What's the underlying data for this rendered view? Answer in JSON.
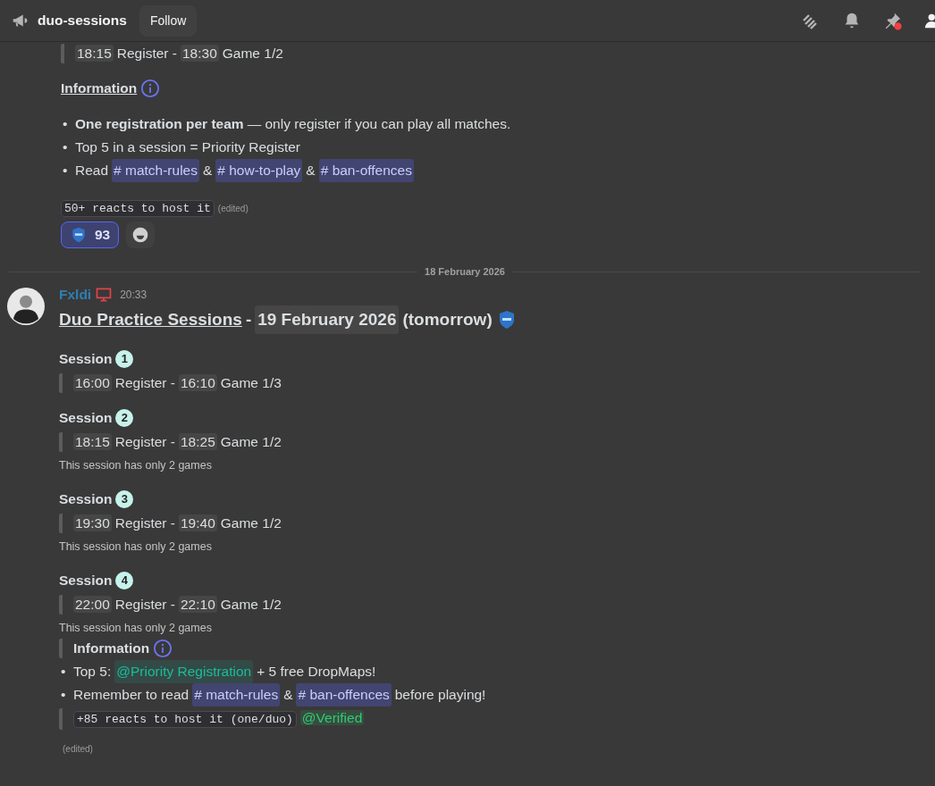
{
  "header": {
    "channel": "duo-sessions",
    "follow_button": "Follow",
    "pins_unread": true
  },
  "previous_message": {
    "blocks": [
      {
        "kind": "quote",
        "segments": [
          {
            "kind": "time",
            "text": "18:15"
          },
          {
            "kind": "text",
            "text": "Register -"
          },
          {
            "kind": "time",
            "text": "18:30"
          },
          {
            "kind": "text",
            "text": "Game 1/2"
          }
        ]
      },
      {
        "kind": "heading",
        "text": "Information"
      },
      {
        "kind": "bullets",
        "items": [
          {
            "marker": "•",
            "segments": [
              {
                "kind": "bold",
                "text": "One registration per team"
              },
              {
                "kind": "text",
                "text": "— only register if you can play all matches."
              }
            ]
          },
          {
            "marker": "•",
            "segments": [
              {
                "kind": "text",
                "text": "Top 5 in a session = Priority Register"
              }
            ]
          },
          {
            "marker": "•",
            "segments": [
              {
                "kind": "text",
                "text": "Read"
              },
              {
                "kind": "channel",
                "text": "# match-rules"
              },
              {
                "kind": "text",
                "text": "&"
              },
              {
                "kind": "channel",
                "text": "# how-to-play"
              },
              {
                "kind": "text",
                "text": "&"
              },
              {
                "kind": "channel",
                "text": "# ban-offences"
              }
            ]
          }
        ]
      },
      {
        "kind": "code_line",
        "segments": [
          {
            "kind": "code",
            "text": "50+ reacts to host it"
          },
          {
            "kind": "edited",
            "text": "(edited)"
          }
        ]
      }
    ],
    "reactions": [
      {
        "count": "93",
        "selected": true
      }
    ]
  },
  "date_divider": "18 February 2026",
  "message": {
    "author": "Fxldi",
    "time": "20:33",
    "title": [
      {
        "kind": "underline",
        "text": "Duo Practice Sessions"
      },
      {
        "kind": "text",
        "text": "-"
      },
      {
        "kind": "time",
        "text": "19 February 2026"
      },
      {
        "kind": "text",
        "text": "(tomorrow)"
      }
    ],
    "blocks": [
      {
        "kind": "session",
        "text": "Session",
        "number": "1"
      },
      {
        "kind": "quote",
        "segments": [
          {
            "kind": "time",
            "text": "16:00"
          },
          {
            "kind": "text",
            "text": "Register -"
          },
          {
            "kind": "time",
            "text": "16:10"
          },
          {
            "kind": "text",
            "text": "Game 1/3"
          }
        ]
      },
      {
        "kind": "session",
        "text": "Session",
        "number": "2"
      },
      {
        "kind": "quote",
        "segments": [
          {
            "kind": "time",
            "text": "18:15"
          },
          {
            "kind": "text",
            "text": "Register -"
          },
          {
            "kind": "time",
            "text": "18:25"
          },
          {
            "kind": "text",
            "text": "Game 1/2"
          }
        ]
      },
      {
        "kind": "note",
        "text": "This session has only 2 games"
      },
      {
        "kind": "session",
        "text": "Session",
        "number": "3"
      },
      {
        "kind": "quote",
        "segments": [
          {
            "kind": "time",
            "text": "19:30"
          },
          {
            "kind": "text",
            "text": "Register -"
          },
          {
            "kind": "time",
            "text": "19:40"
          },
          {
            "kind": "text",
            "text": "Game 1/2"
          }
        ]
      },
      {
        "kind": "note",
        "text": "This session has only 2 games"
      },
      {
        "kind": "session",
        "text": "Session",
        "number": "4"
      },
      {
        "kind": "quote",
        "segments": [
          {
            "kind": "time",
            "text": "22:00"
          },
          {
            "kind": "text",
            "text": "Register -"
          },
          {
            "kind": "time",
            "text": "22:10"
          },
          {
            "kind": "text",
            "text": "Game 1/2"
          }
        ]
      },
      {
        "kind": "note",
        "text": "This session has only 2 games"
      },
      {
        "kind": "quote_heading",
        "text": "Information"
      },
      {
        "kind": "bullets",
        "items": [
          {
            "marker": "•",
            "segments": [
              {
                "kind": "text",
                "text": "Top 5:"
              },
              {
                "kind": "role",
                "text": "@Priority Registration",
                "color": "#1abc9c"
              },
              {
                "kind": "text",
                "text": "+ 5 free DropMaps!"
              }
            ]
          },
          {
            "marker": "•",
            "segments": [
              {
                "kind": "text",
                "text": "Remember to read"
              },
              {
                "kind": "channel",
                "text": "# match-rules"
              },
              {
                "kind": "text",
                "text": "&"
              },
              {
                "kind": "channel",
                "text": "# ban-offences"
              },
              {
                "kind": "text",
                "text": "before playing!"
              }
            ]
          }
        ]
      },
      {
        "kind": "quote",
        "segments": [
          {
            "kind": "code",
            "text": "+85 reacts to host it (one/duo)"
          },
          {
            "kind": "role",
            "text": "@Verified",
            "color": "#2ecc71"
          }
        ]
      },
      {
        "kind": "edited",
        "text": "(edited)"
      }
    ]
  }
}
